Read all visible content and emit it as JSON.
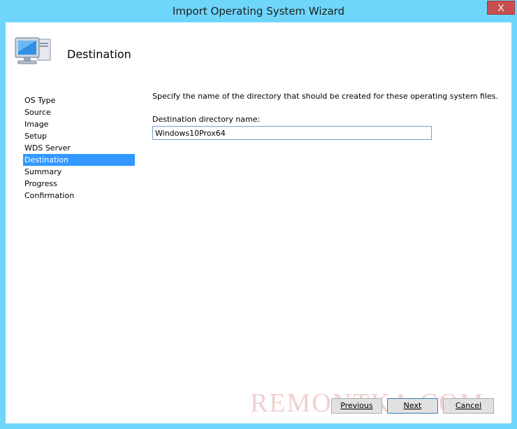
{
  "window": {
    "title": "Import Operating System Wizard",
    "close_glyph": "X"
  },
  "header": {
    "title": "Destination",
    "icon": "computer-icon"
  },
  "nav": {
    "items": [
      {
        "label": "OS Type"
      },
      {
        "label": "Source"
      },
      {
        "label": "Image"
      },
      {
        "label": "Setup"
      },
      {
        "label": "WDS Server"
      },
      {
        "label": "Destination",
        "selected": true
      },
      {
        "label": "Summary"
      },
      {
        "label": "Progress"
      },
      {
        "label": "Confirmation"
      }
    ]
  },
  "main": {
    "description": "Specify the name of the directory that should be created for these operating system files.",
    "field_label": "Destination directory name:",
    "field_value": "Windows10Prox64"
  },
  "buttons": {
    "previous": "Previous",
    "next": "Next",
    "cancel": "Cancel"
  },
  "watermark": "REMONTKA.COM",
  "colors": {
    "frame": "#6fd6fb",
    "selection": "#3399ff",
    "close": "#c7504f"
  }
}
